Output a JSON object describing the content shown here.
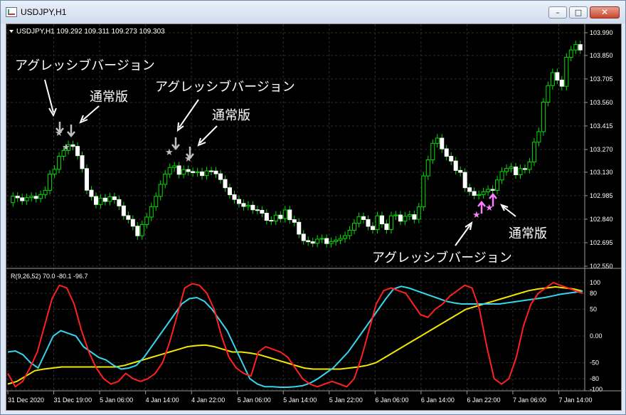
{
  "window": {
    "title": "USDJPY,H1",
    "buttons": {
      "minimize": "–",
      "maximize": "□",
      "close": "✕"
    }
  },
  "price_panel": {
    "header": "USDJPY,H1  109.292 109.311 109.273 109.303",
    "y_ticks": [
      "103.990",
      "103.850",
      "103.705",
      "103.560",
      "103.415",
      "103.270",
      "103.130",
      "102.985",
      "102.840",
      "102.695",
      "102.550"
    ],
    "annotations": {
      "aggressive_1": "アグレッシブバージョン",
      "normal_1": "通常版",
      "aggressive_2": "アグレッシブバージョン",
      "normal_2": "通常版",
      "normal_3": "通常版",
      "aggressive_3": "アグレッシブバージョン"
    }
  },
  "indicator_panel": {
    "header": "R(9,26,52) 70.0 -80.1 -96.7",
    "y_ticks": [
      "100",
      "80",
      "50",
      "0.00",
      "-50",
      "-80",
      "-100"
    ]
  },
  "x_axis": {
    "labels": [
      "31 Dec 2020",
      "31 Dec 19:00",
      "5 Jan 06:00",
      "4 Jan 14:00",
      "4 Jan 22:00",
      "5 Jan 06:00",
      "5 Jan 14:00",
      "5 Jan 22:00",
      "6 Jan 06:00",
      "6 Jan 14:00",
      "6 Jan 22:00",
      "7 Jan 06:00",
      "7 Jan 14:00"
    ]
  },
  "colors": {
    "bg": "#000000",
    "grid": "#2d2d2d",
    "text": "#ffffff",
    "candle": "#00e000",
    "fast": "#ff2020",
    "mid": "#33d6ee",
    "slow": "#f2e600",
    "arrow_down": "#c0c0c0",
    "arrow_up": "#ff7fff"
  },
  "chart_data": {
    "type": "line",
    "ohlc": {
      "open": [
        102.942,
        102.982,
        102.972,
        102.954,
        102.973,
        102.981,
        102.968,
        102.992,
        103.018,
        103.118,
        103.148,
        103.228,
        103.264,
        103.299,
        103.289,
        103.232,
        103.152,
        103.019,
        102.98,
        102.931,
        102.97,
        102.95,
        102.978,
        102.961,
        102.922,
        102.862,
        102.839,
        102.797,
        102.738,
        102.807,
        102.853,
        102.917,
        102.981,
        103.055,
        103.118,
        103.159,
        103.169,
        103.117,
        103.146,
        103.134,
        103.127,
        103.132,
        103.109,
        103.138,
        103.137,
        103.12,
        103.085,
        103.034,
        102.991,
        102.962,
        102.937,
        102.919,
        102.926,
        102.898,
        102.895,
        102.877,
        102.833,
        102.829,
        102.865,
        102.844,
        102.897,
        102.837,
        102.821,
        102.748,
        102.708,
        102.701,
        102.692,
        102.717,
        102.721,
        102.69,
        102.702,
        102.711,
        102.721,
        102.739,
        102.772,
        102.815,
        102.856,
        102.838,
        102.796,
        102.776,
        102.861,
        102.811,
        102.776,
        102.861,
        102.866,
        102.828,
        102.858,
        102.868,
        102.84,
        102.916,
        103.107,
        103.206,
        103.308,
        103.34,
        103.274,
        103.228,
        103.199,
        103.141,
        103.129,
        103.034,
        103.011,
        102.987,
        102.992,
        103.009,
        103.024,
        103.018,
        103.082,
        103.134,
        103.153,
        103.162,
        103.114,
        103.152,
        103.147,
        103.193,
        103.315,
        103.38,
        103.562,
        103.664,
        103.744,
        103.698,
        103.66,
        103.839,
        103.884,
        103.917
      ],
      "close": [
        102.982,
        102.972,
        102.954,
        102.973,
        102.981,
        102.968,
        102.992,
        103.018,
        103.118,
        103.148,
        103.228,
        103.264,
        103.299,
        103.289,
        103.232,
        103.152,
        103.019,
        102.98,
        102.931,
        102.97,
        102.95,
        102.978,
        102.961,
        102.922,
        102.862,
        102.839,
        102.797,
        102.738,
        102.807,
        102.853,
        102.917,
        102.981,
        103.055,
        103.118,
        103.159,
        103.169,
        103.117,
        103.146,
        103.134,
        103.127,
        103.132,
        103.109,
        103.138,
        103.137,
        103.12,
        103.085,
        103.034,
        102.991,
        102.962,
        102.937,
        102.919,
        102.926,
        102.898,
        102.895,
        102.877,
        102.833,
        102.829,
        102.865,
        102.844,
        102.897,
        102.837,
        102.821,
        102.748,
        102.708,
        102.701,
        102.692,
        102.717,
        102.721,
        102.69,
        102.702,
        102.711,
        102.721,
        102.739,
        102.772,
        102.815,
        102.856,
        102.838,
        102.796,
        102.776,
        102.861,
        102.811,
        102.776,
        102.861,
        102.866,
        102.828,
        102.858,
        102.868,
        102.84,
        102.916,
        103.107,
        103.206,
        103.308,
        103.34,
        103.274,
        103.228,
        103.199,
        103.141,
        103.129,
        103.034,
        103.011,
        102.987,
        102.992,
        103.009,
        103.024,
        103.018,
        103.082,
        103.134,
        103.153,
        103.162,
        103.114,
        103.152,
        103.147,
        103.193,
        103.315,
        103.38,
        103.562,
        103.664,
        103.744,
        103.698,
        103.66,
        103.839,
        103.884,
        103.917,
        103.884
      ]
    },
    "indicator_red": [
      -70,
      -95,
      -85,
      -60,
      -30,
      20,
      70,
      95,
      90,
      60,
      10,
      -30,
      -60,
      -80,
      -90,
      -85,
      -70,
      -80,
      -85,
      -80,
      -70,
      -50,
      -10,
      40,
      90,
      98,
      95,
      80,
      50,
      0,
      -40,
      -60,
      -70,
      -75,
      -30,
      -20,
      -25,
      -30,
      -40,
      -60,
      -80,
      -90,
      -95,
      -90,
      -85,
      -90,
      -95,
      -80,
      -40,
      10,
      60,
      85,
      90,
      85,
      80,
      60,
      40,
      35,
      50,
      60,
      75,
      85,
      95,
      90,
      50,
      -20,
      -80,
      -90,
      -80,
      -40,
      20,
      60,
      80,
      90,
      100,
      95,
      90,
      85,
      80
    ],
    "indicator_cyan": [
      -30,
      -28,
      -35,
      -50,
      -60,
      -30,
      0,
      10,
      5,
      0,
      -20,
      -30,
      -40,
      -45,
      -55,
      -62,
      -60,
      -55,
      -40,
      -20,
      0,
      20,
      40,
      60,
      70,
      72,
      65,
      50,
      30,
      10,
      -20,
      -50,
      -80,
      -90,
      -95,
      -95,
      -96,
      -96,
      -95,
      -93,
      -88,
      -80,
      -70,
      -60,
      -45,
      -30,
      -10,
      10,
      30,
      50,
      70,
      88,
      93,
      90,
      85,
      80,
      75,
      70,
      65,
      62,
      60,
      60,
      60,
      60,
      60,
      60,
      62,
      64,
      66,
      68,
      70,
      72,
      75,
      78,
      80,
      82,
      84
    ],
    "indicator_yellow": [
      -90,
      -85,
      -75,
      -65,
      -62,
      -60,
      -58,
      -58,
      -58,
      -58,
      -58,
      -58,
      -58,
      -55,
      -50,
      -45,
      -40,
      -35,
      -30,
      -25,
      -20,
      -18,
      -17,
      -20,
      -25,
      -30,
      -30,
      -32,
      -35,
      -40,
      -45,
      -50,
      -55,
      -60,
      -62,
      -62,
      -62,
      -62,
      -60,
      -58,
      -55,
      -50,
      -40,
      -30,
      -20,
      -10,
      0,
      10,
      20,
      30,
      40,
      50,
      55,
      60,
      65,
      70,
      75,
      80,
      85,
      88,
      90,
      92,
      90,
      88,
      84
    ]
  }
}
